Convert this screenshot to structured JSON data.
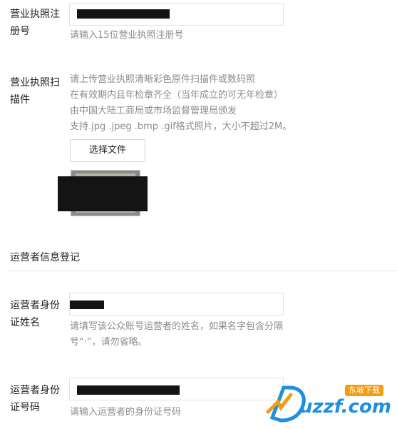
{
  "license_no": {
    "label_line1": "营业执照注",
    "label_line2": "册号",
    "hint": "请输入15位营业执照注册号"
  },
  "license_scan": {
    "label_line1": "营业执照扫",
    "label_line2": "描件",
    "hints": [
      "请上传营业执照清晰彩色原件扫描件或数码照",
      "在有效期内且年检章齐全（当年成立的可无年检章）",
      "由中国大陆工商局或市场监督管理局颁发",
      "支持.jpg .jpeg .bmp .gif格式照片，大小不超过2M。"
    ],
    "choose_file_label": "选择文件"
  },
  "operator_section": {
    "title": "运营者信息登记"
  },
  "operator_name": {
    "label_line1": "运营者身份",
    "label_line2": "证姓名",
    "hints": [
      "请填写该公众账号运营者的姓名，如果名字包含分隔",
      "号“·”，请勿省略。"
    ]
  },
  "operator_id": {
    "label_line1": "运营者身份",
    "label_line2": "证号码",
    "hint": "请输入运营者的身份证号码"
  },
  "watermark": {
    "brand": "uzzf.com",
    "tagline": "东坡下载"
  },
  "colors": {
    "label": "#222222",
    "hint": "#8c8c8c",
    "border": "#e4e4e4",
    "redaction": "#141414",
    "watermark_blue": "#1e8fe0",
    "watermark_orange": "#f39c12"
  }
}
